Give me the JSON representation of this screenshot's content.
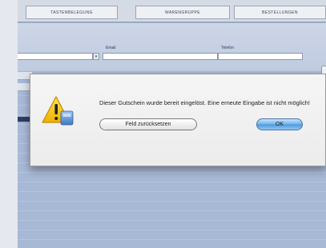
{
  "tabs": [
    {
      "label": "TASTENBELEGUNG"
    },
    {
      "label": "WARENGRUPPE"
    },
    {
      "label": "BESTELLUNGEN"
    }
  ],
  "form": {
    "email_label": "Email",
    "telefon_label": "Telefon"
  },
  "dialog": {
    "message": "Dieser Gutschein wurde bereit eingelöst. Eine erneute Eingabe ist nicht möglich!",
    "reset_button": "Feld zurücksetzen",
    "ok_button": "OK",
    "icon": "warning-triangle-icon"
  },
  "colors": {
    "background_lines": "#a8b9d6",
    "ok_button": "#4d98dc",
    "warning": "#f5c400"
  }
}
